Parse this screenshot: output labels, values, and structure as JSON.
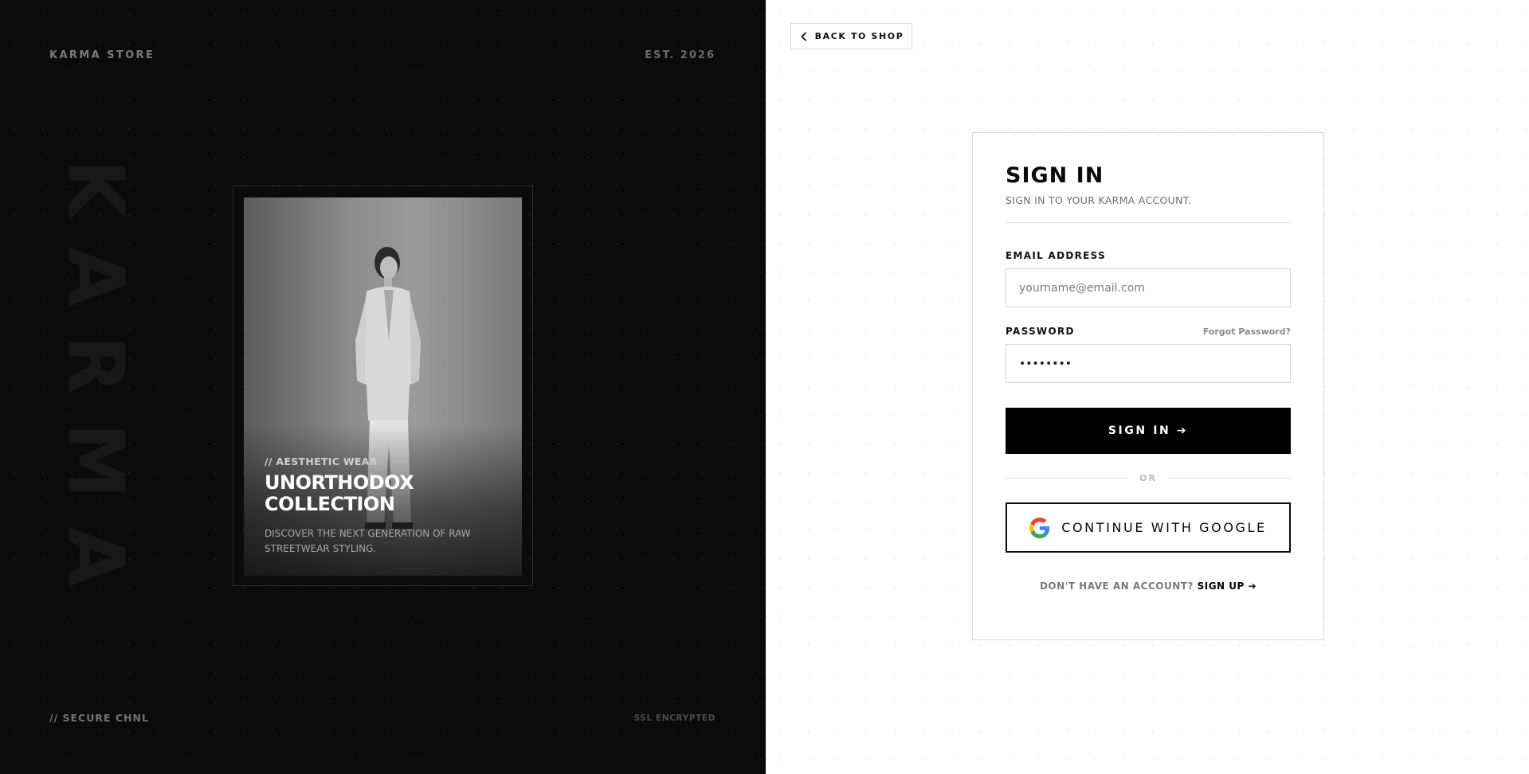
{
  "left": {
    "brand": "KARMA STORE",
    "established": "EST. 2026",
    "vertical_word": "KARMA",
    "card": {
      "kicker": "// AESTHETIC WEAR",
      "title": "UNORTHODOX COLLECTION",
      "description": "DISCOVER THE NEXT GENERATION OF RAW STREETWEAR STYLING."
    },
    "footer_left": "// SECURE CHNL",
    "footer_right": "SSL ENCRYPTED"
  },
  "right": {
    "back_button": {
      "label": "BACK TO SHOP",
      "icon": "chevron-left-icon"
    },
    "form": {
      "title": "SIGN IN",
      "subtitle": "SIGN IN TO YOUR KARMA ACCOUNT.",
      "email": {
        "label": "EMAIL ADDRESS",
        "placeholder": "yourname@email.com",
        "value": ""
      },
      "password": {
        "label": "PASSWORD",
        "value": "••••••••",
        "forgot_label": "Forgot Password?"
      },
      "submit_label": "SIGN IN ➔",
      "separator": "OR",
      "google": {
        "label": "CONTINUE WITH GOOGLE",
        "icon": "google-icon"
      },
      "signup": {
        "question": "DON'T HAVE AN ACCOUNT?",
        "link": "SIGN UP ➔"
      }
    }
  },
  "colors": {
    "left_background": "#0b0b0b",
    "right_background": "#ffffff",
    "primary_button": "#000000"
  }
}
